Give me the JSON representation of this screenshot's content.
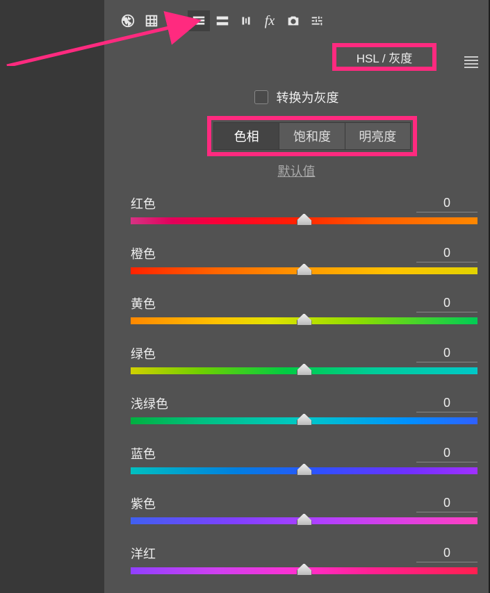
{
  "toolbar_icons": [
    "aperture-icon",
    "grid-icon",
    "mountains-icon",
    "hsl-icon",
    "split-tone-icon",
    "lens-icon",
    "fx-icon",
    "camera-icon",
    "adjustments-icon"
  ],
  "panel_title": "HSL / 灰度",
  "convert_grayscale_label": "转换为灰度",
  "tabs": [
    {
      "label": "色相",
      "active": true
    },
    {
      "label": "饱和度",
      "active": false
    },
    {
      "label": "明亮度",
      "active": false
    }
  ],
  "defaults_label": "默认值",
  "sliders": [
    {
      "label": "红色",
      "value": 0,
      "gradient": "gr-red"
    },
    {
      "label": "橙色",
      "value": 0,
      "gradient": "gr-orange"
    },
    {
      "label": "黄色",
      "value": 0,
      "gradient": "gr-yellow"
    },
    {
      "label": "绿色",
      "value": 0,
      "gradient": "gr-green"
    },
    {
      "label": "浅绿色",
      "value": 0,
      "gradient": "gr-aqua"
    },
    {
      "label": "蓝色",
      "value": 0,
      "gradient": "gr-blue"
    },
    {
      "label": "紫色",
      "value": 0,
      "gradient": "gr-purple"
    },
    {
      "label": "洋红",
      "value": 0,
      "gradient": "gr-magenta"
    }
  ],
  "annotations": {
    "arrow_color": "#ff2a7f",
    "highlight_color": "#ff2a7f"
  }
}
